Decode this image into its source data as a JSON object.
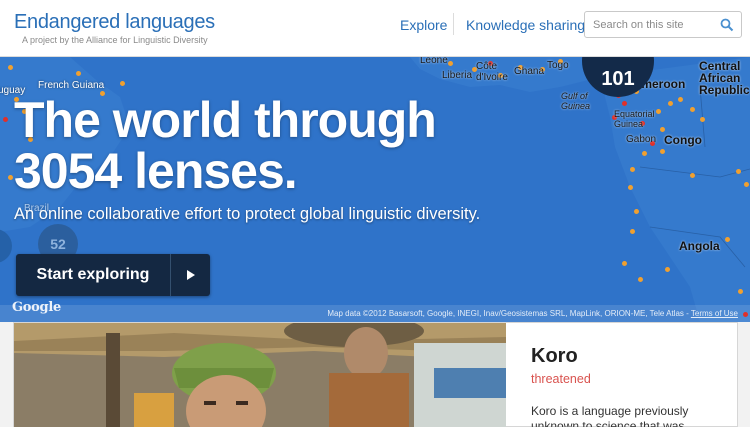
{
  "header": {
    "title": "Endangered languages",
    "subtitle": "A project by the Alliance for Linguistic Diversity",
    "nav": [
      {
        "label": "Explore"
      },
      {
        "label": "Knowledge sharing"
      }
    ],
    "search": {
      "placeholder": "Search on this site",
      "value": ""
    }
  },
  "hero": {
    "title_line1": "The world through",
    "title_line2": "3054 lenses.",
    "subtitle": "An online collaborative effort to protect global linguistic diversity.",
    "cta_label": "Start exploring"
  },
  "map": {
    "places": {
      "french_guiana": "French Guiana",
      "leone": "Leone",
      "liberia": "Liberia",
      "cote_divoire": "Côte\nd'Ivoire",
      "ghana": "Ghana",
      "togo": "Togo",
      "gulf_of_guinea": "Gulf of\nGuinea",
      "cameroon": "Cameroon",
      "central_african_republic": "Central\nAfrican\nRepublic",
      "equatorial_guinea": "Equatorial\nGuinea",
      "gabon": "Gabon",
      "congo": "Congo",
      "angola": "Angola",
      "brazil": "Brazil",
      "uguay": "uguay"
    },
    "clusters": {
      "top": "101",
      "left": "52"
    },
    "google": "Google",
    "attribution_text": "Map data ©2012 Basarsoft, Google, INEGI, Inav/Geosistemas SRL, MapLink, ORION-ME, Tele Atlas - ",
    "attribution_link": "Terms of Use"
  },
  "card": {
    "language": "Koro",
    "status": "threatened",
    "description": "Koro is a language previously unknown to science that was"
  },
  "colors": {
    "brand_blue": "#2a6fb7",
    "map_ocean": "#2f73c9",
    "cta_bg": "#142842",
    "status_red": "#d9534f",
    "dot_orange": "#f0a030",
    "dot_red": "#e0302a"
  }
}
